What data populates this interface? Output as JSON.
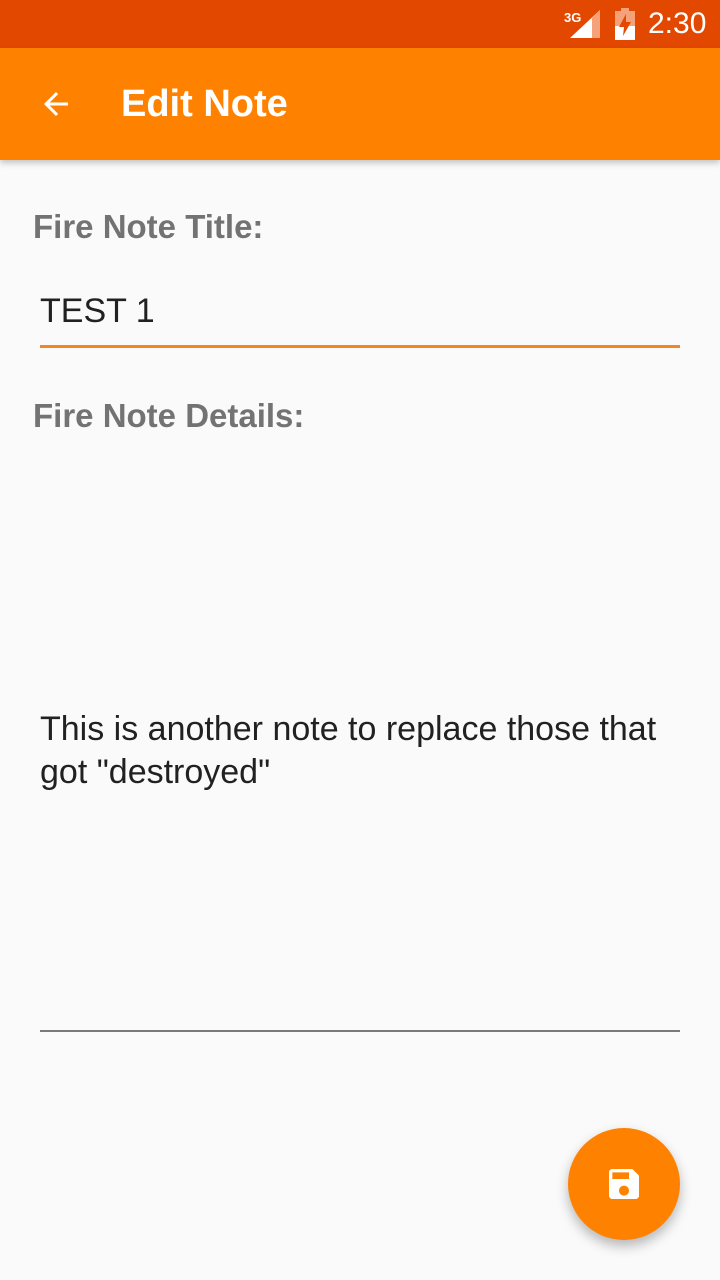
{
  "status_bar": {
    "network": "3G",
    "time": "2:30",
    "icons": [
      "signal-icon",
      "battery-charging-icon"
    ],
    "color": "#e34800"
  },
  "app_bar": {
    "title": "Edit Note",
    "back_icon": "arrow-back-icon",
    "color": "#ff8100"
  },
  "form": {
    "title_label": "Fire Note Title:",
    "title_value": "TEST 1",
    "details_label": "Fire Note Details:",
    "details_value": "This is another note to replace those that got \"destroyed\"",
    "accent_color": "#f08a1c"
  },
  "fab": {
    "icon": "save-icon",
    "color": "#ff8100"
  }
}
